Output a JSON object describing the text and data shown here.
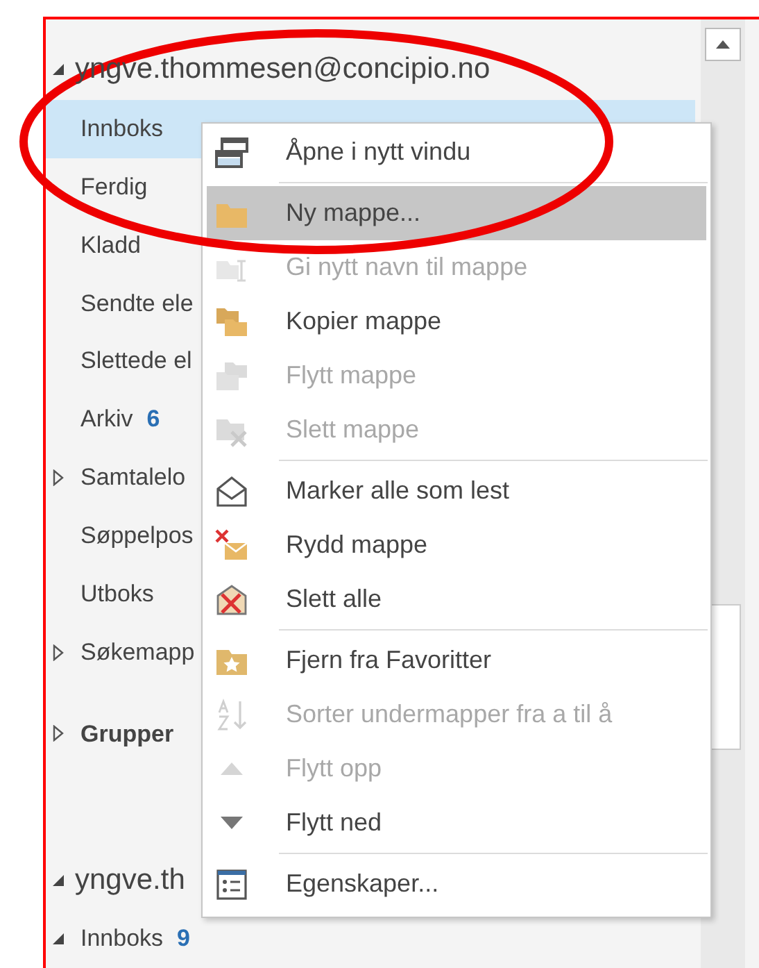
{
  "folder_pane": {
    "items": [
      {
        "kind": "account",
        "label": "yngve.thommesen@concipio.no",
        "expanded": true
      },
      {
        "kind": "folder",
        "label": "Innboks",
        "selected": true
      },
      {
        "kind": "folder",
        "label": "Ferdig",
        "selected": false
      },
      {
        "kind": "folder",
        "label": "Kladd",
        "selected": false
      },
      {
        "kind": "folder",
        "label": "Sendte ele",
        "selected": false
      },
      {
        "kind": "folder",
        "label": "Slettede el",
        "selected": false
      },
      {
        "kind": "folder",
        "label": "Arkiv",
        "count": "6",
        "selected": false
      },
      {
        "kind": "folder",
        "label": "Samtalelo",
        "expanded": false,
        "selected": false
      },
      {
        "kind": "folder",
        "label": "Søppelpos",
        "selected": false
      },
      {
        "kind": "folder",
        "label": "Utboks",
        "selected": false
      },
      {
        "kind": "folder",
        "label": "Søkemapp",
        "expanded": false,
        "selected": false
      },
      {
        "kind": "group",
        "label": "Grupper",
        "expanded": false,
        "selected": false
      },
      {
        "kind": "account",
        "label": "yngve.th",
        "expanded": true
      },
      {
        "kind": "folder",
        "label": "Innboks",
        "count": "9",
        "expanded": true,
        "selected": false
      }
    ]
  },
  "context_menu": {
    "items": [
      {
        "kind": "item",
        "label": "Åpne i nytt vindu",
        "disabled": false,
        "selected": false
      },
      {
        "kind": "separator"
      },
      {
        "kind": "item",
        "label": "Ny mappe...",
        "disabled": false,
        "selected": true
      },
      {
        "kind": "item",
        "label": "Gi nytt navn til mappe",
        "disabled": true,
        "selected": false
      },
      {
        "kind": "item",
        "label": "Kopier mappe",
        "disabled": false,
        "selected": false
      },
      {
        "kind": "item",
        "label": "Flytt mappe",
        "disabled": true,
        "selected": false
      },
      {
        "kind": "item",
        "label": "Slett mappe",
        "disabled": true,
        "selected": false
      },
      {
        "kind": "separator"
      },
      {
        "kind": "item",
        "label": "Marker alle som lest",
        "disabled": false,
        "selected": false
      },
      {
        "kind": "item",
        "label": "Rydd mappe",
        "disabled": false,
        "selected": false
      },
      {
        "kind": "item",
        "label": "Slett alle",
        "disabled": false,
        "selected": false
      },
      {
        "kind": "separator"
      },
      {
        "kind": "item",
        "label": "Fjern fra Favoritter",
        "disabled": false,
        "selected": false
      },
      {
        "kind": "item",
        "label": "Sorter undermapper fra a til å",
        "disabled": true,
        "selected": false
      },
      {
        "kind": "item",
        "label": "Flytt opp",
        "disabled": true,
        "selected": false
      },
      {
        "kind": "item",
        "label": "Flytt ned",
        "disabled": false,
        "selected": false
      },
      {
        "kind": "separator"
      },
      {
        "kind": "item",
        "label": "Egenskaper...",
        "disabled": false,
        "selected": false
      }
    ]
  }
}
